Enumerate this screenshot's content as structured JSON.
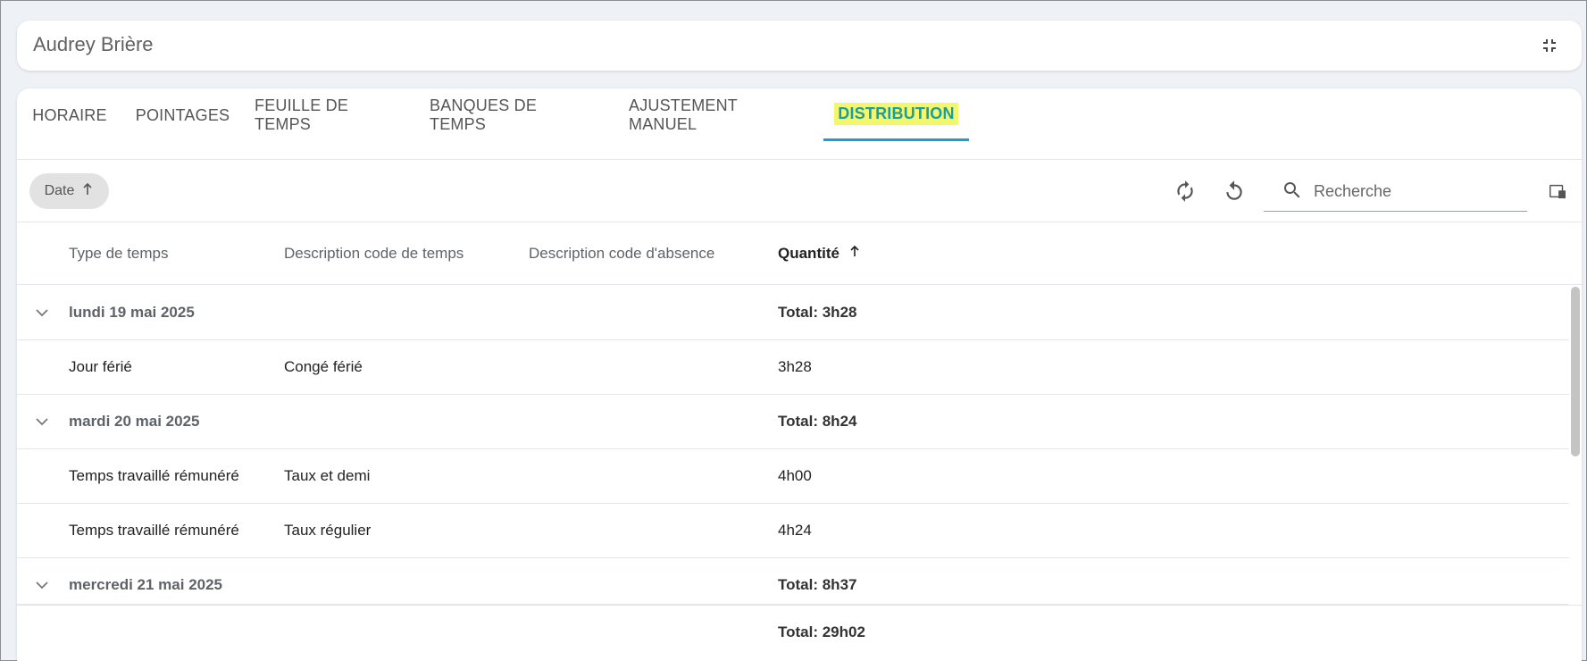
{
  "header": {
    "title": "Audrey Brière",
    "collapse_icon": "collapse-fullscreen-icon"
  },
  "tabs": [
    {
      "label": "HORAIRE"
    },
    {
      "label": "POINTAGES"
    },
    {
      "label": "FEUILLE DE TEMPS"
    },
    {
      "label": "BANQUES DE TEMPS"
    },
    {
      "label": "AJUSTEMENT MANUEL"
    },
    {
      "label": "DISTRIBUTION",
      "active": true
    }
  ],
  "toolbar": {
    "sort_chip_label": "Date",
    "sort_chip_icon": "arrow-up-icon",
    "search_placeholder": "Recherche",
    "refresh_icon": "refresh-icon",
    "reset_icon": "undo-icon",
    "columns_icon": "column-settings-icon"
  },
  "table": {
    "columns": [
      "Type de temps",
      "Description code de temps",
      "Description code d'absence",
      "Quantité"
    ],
    "sorted_column": "Quantité",
    "groups": [
      {
        "date": "lundi 19 mai 2025",
        "total": "Total: 3h28",
        "rows": [
          {
            "type": "Jour férié",
            "code_desc": "Congé férié",
            "absence_desc": "",
            "qty": "3h28"
          }
        ]
      },
      {
        "date": "mardi 20 mai 2025",
        "total": "Total: 8h24",
        "rows": [
          {
            "type": "Temps travaillé rémunéré",
            "code_desc": "Taux et demi",
            "absence_desc": "",
            "qty": "4h00"
          },
          {
            "type": "Temps travaillé rémunéré",
            "code_desc": "Taux régulier",
            "absence_desc": "",
            "qty": "4h24"
          }
        ]
      },
      {
        "date": "mercredi 21 mai 2025",
        "total": "Total: 8h37",
        "rows": []
      }
    ],
    "grand_total": "Total: 29h02"
  },
  "colors": {
    "active_tab_text": "#1a9e9e",
    "active_tab_underline": "#1aa0d0",
    "highlight": "#f4f76b"
  }
}
